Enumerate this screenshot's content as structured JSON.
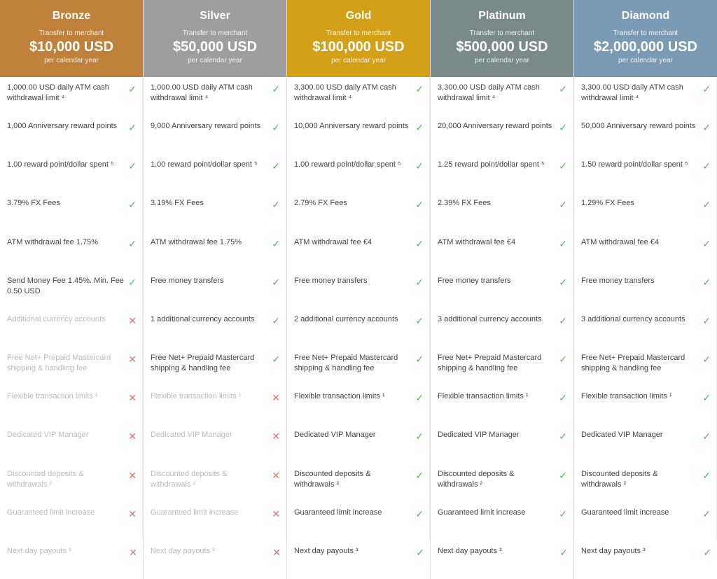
{
  "tiers": [
    {
      "id": "bronze",
      "name": "Bronze",
      "header_class": "bronze-header",
      "transfer_label": "Transfer to merchant",
      "amount": "$10,000 USD",
      "per_year": "per calendar year"
    },
    {
      "id": "silver",
      "name": "Silver",
      "header_class": "silver-header",
      "transfer_label": "Transfer to merchant",
      "amount": "$50,000 USD",
      "per_year": "per calendar year"
    },
    {
      "id": "gold",
      "name": "Gold",
      "header_class": "gold-header",
      "transfer_label": "Transfer to merchant",
      "amount": "$100,000 USD",
      "per_year": "per calendar year"
    },
    {
      "id": "platinum",
      "name": "Platinum",
      "header_class": "platinum-header",
      "transfer_label": "Transfer to merchant",
      "amount": "$500,000 USD",
      "per_year": "per calendar year"
    },
    {
      "id": "diamond",
      "name": "Diamond",
      "header_class": "diamond-header",
      "transfer_label": "Transfer to merchant",
      "amount": "$2,000,000 USD",
      "per_year": "per calendar year"
    }
  ],
  "features": [
    {
      "cells": [
        {
          "text": "1,000.00 USD daily ATM cash withdrawal limit ⁴",
          "enabled": true
        },
        {
          "text": "1,000.00 USD daily ATM cash withdrawal limit ⁴",
          "enabled": true
        },
        {
          "text": "3,300.00 USD daily ATM cash withdrawal limit ⁴",
          "enabled": true
        },
        {
          "text": "3,300.00 USD daily ATM cash withdrawal limit ⁴",
          "enabled": true
        },
        {
          "text": "3,300.00 USD daily ATM cash withdrawal limit ⁴",
          "enabled": true
        }
      ]
    },
    {
      "cells": [
        {
          "text": "1,000 Anniversary reward points",
          "enabled": true
        },
        {
          "text": "9,000 Anniversary reward points",
          "enabled": true
        },
        {
          "text": "10,000 Anniversary reward points",
          "enabled": true
        },
        {
          "text": "20,000 Anniversary reward points",
          "enabled": true
        },
        {
          "text": "50,000 Anniversary reward points",
          "enabled": true
        }
      ]
    },
    {
      "cells": [
        {
          "text": "1.00 reward point/dollar spent ⁵",
          "enabled": true
        },
        {
          "text": "1.00 reward point/dollar spent ⁵",
          "enabled": true
        },
        {
          "text": "1.00 reward point/dollar spent ⁵",
          "enabled": true
        },
        {
          "text": "1.25 reward point/dollar spent ⁵",
          "enabled": true
        },
        {
          "text": "1.50 reward point/dollar spent ⁵",
          "enabled": true
        }
      ]
    },
    {
      "cells": [
        {
          "text": "3.79% FX Fees",
          "enabled": true
        },
        {
          "text": "3.19% FX Fees",
          "enabled": true
        },
        {
          "text": "2.79% FX Fees",
          "enabled": true
        },
        {
          "text": "2.39% FX Fees",
          "enabled": true
        },
        {
          "text": "1.29% FX Fees",
          "enabled": true
        }
      ]
    },
    {
      "cells": [
        {
          "text": "ATM withdrawal fee 1.75%",
          "enabled": true
        },
        {
          "text": "ATM withdrawal fee 1.75%",
          "enabled": true
        },
        {
          "text": "ATM withdrawal fee €4",
          "enabled": true
        },
        {
          "text": "ATM withdrawal fee €4",
          "enabled": true
        },
        {
          "text": "ATM withdrawal fee €4",
          "enabled": true
        }
      ]
    },
    {
      "cells": [
        {
          "text": "Send Money Fee 1.45%. Min. Fee 0.50 USD",
          "enabled": true
        },
        {
          "text": "Free money transfers",
          "enabled": true
        },
        {
          "text": "Free money transfers",
          "enabled": true
        },
        {
          "text": "Free money transfers",
          "enabled": true
        },
        {
          "text": "Free money transfers",
          "enabled": true
        }
      ]
    },
    {
      "cells": [
        {
          "text": "Additional currency accounts",
          "enabled": false
        },
        {
          "text": "1 additional currency accounts",
          "enabled": true
        },
        {
          "text": "2 additional currency accounts",
          "enabled": true
        },
        {
          "text": "3 additional currency accounts",
          "enabled": true
        },
        {
          "text": "3 additional currency accounts",
          "enabled": true
        }
      ]
    },
    {
      "cells": [
        {
          "text": "Free Net+ Prepaid Mastercard shipping & handling fee",
          "enabled": false
        },
        {
          "text": "Free Net+ Prepaid Mastercard shipping & handling fee",
          "enabled": true
        },
        {
          "text": "Free Net+ Prepaid Mastercard shipping & handling fee",
          "enabled": true
        },
        {
          "text": "Free Net+ Prepaid Mastercard shipping & handling fee",
          "enabled": true
        },
        {
          "text": "Free Net+ Prepaid Mastercard shipping & handling fee",
          "enabled": true
        }
      ]
    },
    {
      "cells": [
        {
          "text": "Flexible transaction limits ¹",
          "enabled": false
        },
        {
          "text": "Flexible transaction limits ¹",
          "enabled": false
        },
        {
          "text": "Flexible transaction limits ¹",
          "enabled": true
        },
        {
          "text": "Flexible transaction limits ¹",
          "enabled": true
        },
        {
          "text": "Flexible transaction limits ¹",
          "enabled": true
        }
      ]
    },
    {
      "cells": [
        {
          "text": "Dedicated VIP Manager",
          "enabled": false
        },
        {
          "text": "Dedicated VIP Manager",
          "enabled": false
        },
        {
          "text": "Dedicated VIP Manager",
          "enabled": true
        },
        {
          "text": "Dedicated VIP Manager",
          "enabled": true
        },
        {
          "text": "Dedicated VIP Manager",
          "enabled": true
        }
      ]
    },
    {
      "cells": [
        {
          "text": "Discounted deposits & withdrawals ²",
          "enabled": false
        },
        {
          "text": "Discounted deposits & withdrawals ²",
          "enabled": false
        },
        {
          "text": "Discounted deposits & withdrawals ²",
          "enabled": true
        },
        {
          "text": "Discounted deposits & withdrawals ²",
          "enabled": true
        },
        {
          "text": "Discounted deposits & withdrawals ²",
          "enabled": true
        }
      ]
    },
    {
      "cells": [
        {
          "text": "Guaranteed limit increase",
          "enabled": false
        },
        {
          "text": "Guaranteed limit increase",
          "enabled": false
        },
        {
          "text": "Guaranteed limit increase",
          "enabled": true
        },
        {
          "text": "Guaranteed limit increase",
          "enabled": true
        },
        {
          "text": "Guaranteed limit increase",
          "enabled": true
        }
      ]
    },
    {
      "cells": [
        {
          "text": "Next day payouts ³",
          "enabled": false
        },
        {
          "text": "Next day payouts ³",
          "enabled": false
        },
        {
          "text": "Next day payouts ³",
          "enabled": true
        },
        {
          "text": "Next day payouts ³",
          "enabled": true
        },
        {
          "text": "Next day payouts ³",
          "enabled": true
        }
      ]
    }
  ],
  "icons": {
    "check": "✓",
    "cross": "✕"
  }
}
